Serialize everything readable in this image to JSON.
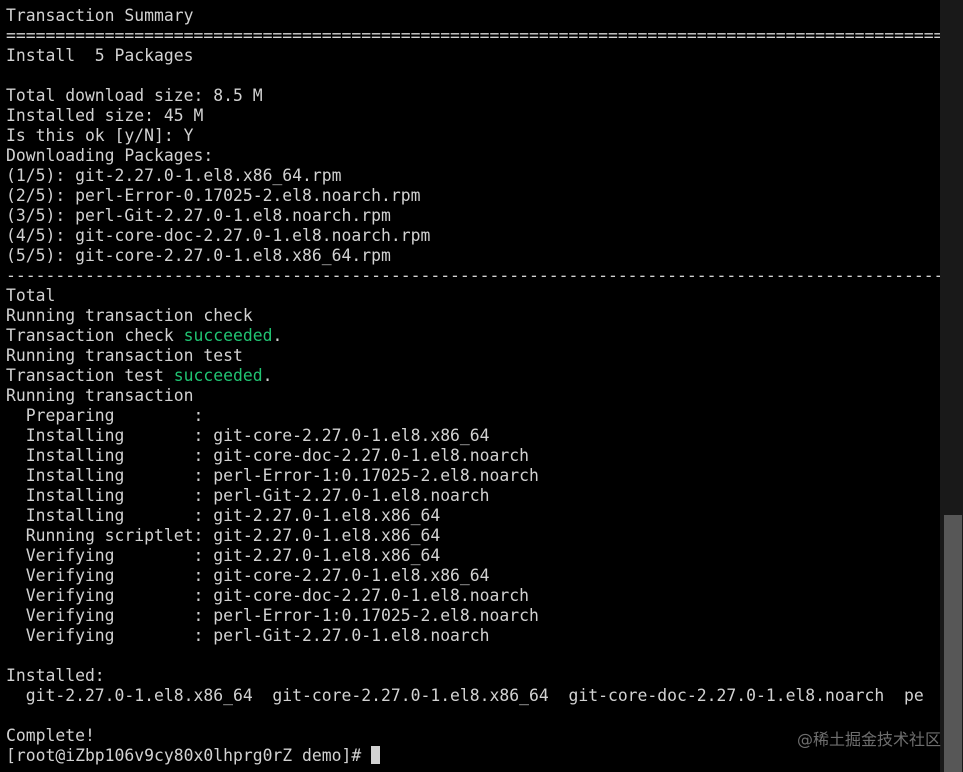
{
  "terminal": {
    "lines": [
      {
        "text": "Transaction Summary"
      },
      {
        "text": "================================================================================================================================================="
      },
      {
        "text": "Install  5 Packages"
      },
      {
        "text": ""
      },
      {
        "text": "Total download size: 8.5 M"
      },
      {
        "text": "Installed size: 45 M"
      },
      {
        "text": "Is this ok [y/N]: Y"
      },
      {
        "text": "Downloading Packages:"
      },
      {
        "text": "(1/5): git-2.27.0-1.el8.x86_64.rpm"
      },
      {
        "text": "(2/5): perl-Error-0.17025-2.el8.noarch.rpm"
      },
      {
        "text": "(3/5): perl-Git-2.27.0-1.el8.noarch.rpm"
      },
      {
        "text": "(4/5): git-core-doc-2.27.0-1.el8.noarch.rpm"
      },
      {
        "text": "(5/5): git-core-2.27.0-1.el8.x86_64.rpm"
      },
      {
        "text": "-------------------------------------------------------------------------------------------------------------------------------------------------"
      },
      {
        "text": "Total"
      },
      {
        "text": "Running transaction check"
      },
      {
        "before": "Transaction check ",
        "status": "succeeded",
        "after": "."
      },
      {
        "text": "Running transaction test"
      },
      {
        "before": "Transaction test ",
        "status": "succeeded",
        "after": "."
      },
      {
        "text": "Running transaction"
      },
      {
        "text": "  Preparing        :"
      },
      {
        "text": "  Installing       : git-core-2.27.0-1.el8.x86_64"
      },
      {
        "text": "  Installing       : git-core-doc-2.27.0-1.el8.noarch"
      },
      {
        "text": "  Installing       : perl-Error-1:0.17025-2.el8.noarch"
      },
      {
        "text": "  Installing       : perl-Git-2.27.0-1.el8.noarch"
      },
      {
        "text": "  Installing       : git-2.27.0-1.el8.x86_64"
      },
      {
        "text": "  Running scriptlet: git-2.27.0-1.el8.x86_64"
      },
      {
        "text": "  Verifying        : git-2.27.0-1.el8.x86_64"
      },
      {
        "text": "  Verifying        : git-core-2.27.0-1.el8.x86_64"
      },
      {
        "text": "  Verifying        : git-core-doc-2.27.0-1.el8.noarch"
      },
      {
        "text": "  Verifying        : perl-Error-1:0.17025-2.el8.noarch"
      },
      {
        "text": "  Verifying        : perl-Git-2.27.0-1.el8.noarch"
      },
      {
        "text": ""
      },
      {
        "text": "Installed:"
      },
      {
        "text": "  git-2.27.0-1.el8.x86_64  git-core-2.27.0-1.el8.x86_64  git-core-doc-2.27.0-1.el8.noarch  pe"
      },
      {
        "text": ""
      },
      {
        "text": "Complete!"
      }
    ],
    "prompt": "[root@iZbp106v9cy80x0lhprg0rZ demo]# ",
    "colors": {
      "background": "#000000",
      "foreground": "#d2d2d2",
      "success": "#20c472",
      "scrollbar_track": "#191919",
      "scrollbar_thumb": "#575757"
    }
  },
  "watermark": {
    "text": "@稀土掘金技术社区"
  }
}
